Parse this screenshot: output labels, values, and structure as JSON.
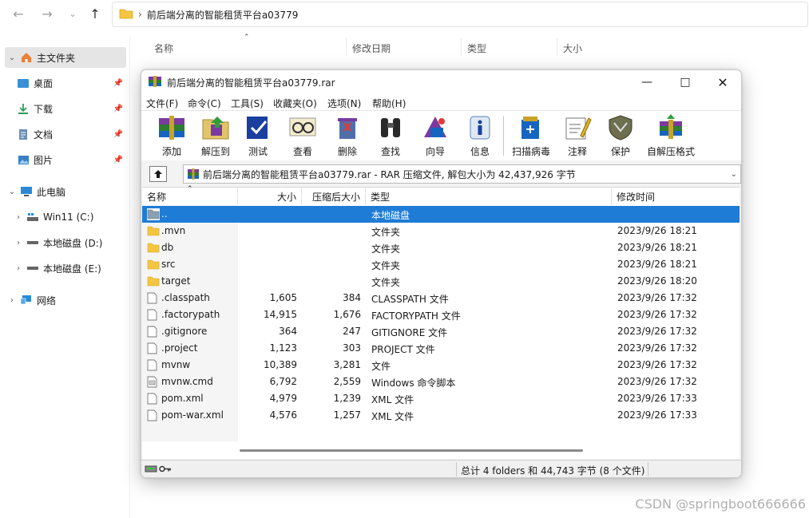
{
  "explorer": {
    "address_path": "前后端分离的智能租赁平台a03779",
    "columns": [
      "名称",
      "修改日期",
      "类型",
      "大小"
    ],
    "sidebar": [
      {
        "label": "主文件夹",
        "icon": "home-icon",
        "selected": true
      },
      {
        "label": "桌面",
        "icon": "desktop-icon",
        "pinned": true
      },
      {
        "label": "下载",
        "icon": "download-icon",
        "pinned": true
      },
      {
        "label": "文档",
        "icon": "document-icon",
        "pinned": true
      },
      {
        "label": "图片",
        "icon": "picture-icon",
        "pinned": true
      },
      {
        "label": "此电脑",
        "icon": "computer-icon"
      },
      {
        "label": "Win11 (C:)",
        "icon": "windows-drive-icon"
      },
      {
        "label": "本地磁盘 (D:)",
        "icon": "drive-icon"
      },
      {
        "label": "本地磁盘 (E:)",
        "icon": "drive-icon"
      },
      {
        "label": "网络",
        "icon": "network-icon"
      }
    ]
  },
  "rar": {
    "title": "前后端分离的智能租赁平台a03779.rar",
    "menu": [
      "文件(F)",
      "命令(C)",
      "工具(S)",
      "收藏夹(O)",
      "选项(N)",
      "帮助(H)"
    ],
    "toolbar": [
      "添加",
      "解压到",
      "测试",
      "查看",
      "删除",
      "查找",
      "向导",
      "信息",
      "扫描病毒",
      "注释",
      "保护",
      "自解压格式"
    ],
    "path": "前后端分离的智能租赁平台a03779.rar - RAR 压缩文件, 解包大小为 42,437,926 字节",
    "columns": {
      "name": "名称",
      "size": "大小",
      "packed": "压缩后大小",
      "type": "类型",
      "modified": "修改时间"
    },
    "files": [
      {
        "name": "..",
        "size": "",
        "packed": "",
        "type": "本地磁盘",
        "modified": "",
        "kind": "up",
        "selected": true
      },
      {
        "name": ".mvn",
        "size": "",
        "packed": "",
        "type": "文件夹",
        "modified": "2023/9/26 18:21",
        "kind": "folder"
      },
      {
        "name": "db",
        "size": "",
        "packed": "",
        "type": "文件夹",
        "modified": "2023/9/26 18:21",
        "kind": "folder"
      },
      {
        "name": "src",
        "size": "",
        "packed": "",
        "type": "文件夹",
        "modified": "2023/9/26 18:21",
        "kind": "folder"
      },
      {
        "name": "target",
        "size": "",
        "packed": "",
        "type": "文件夹",
        "modified": "2023/9/26 18:20",
        "kind": "folder"
      },
      {
        "name": ".classpath",
        "size": "1,605",
        "packed": "384",
        "type": "CLASSPATH 文件",
        "modified": "2023/9/26 17:32",
        "kind": "file"
      },
      {
        "name": ".factorypath",
        "size": "14,915",
        "packed": "1,676",
        "type": "FACTORYPATH 文件",
        "modified": "2023/9/26 17:32",
        "kind": "file"
      },
      {
        "name": ".gitignore",
        "size": "364",
        "packed": "247",
        "type": "GITIGNORE 文件",
        "modified": "2023/9/26 17:32",
        "kind": "file"
      },
      {
        "name": ".project",
        "size": "1,123",
        "packed": "303",
        "type": "PROJECT 文件",
        "modified": "2023/9/26 17:32",
        "kind": "file"
      },
      {
        "name": "mvnw",
        "size": "10,389",
        "packed": "3,281",
        "type": "文件",
        "modified": "2023/9/26 17:32",
        "kind": "file"
      },
      {
        "name": "mvnw.cmd",
        "size": "6,792",
        "packed": "2,559",
        "type": "Windows 命令脚本",
        "modified": "2023/9/26 17:32",
        "kind": "cmd"
      },
      {
        "name": "pom.xml",
        "size": "4,979",
        "packed": "1,239",
        "type": "XML 文件",
        "modified": "2023/9/26 17:33",
        "kind": "file"
      },
      {
        "name": "pom-war.xml",
        "size": "4,576",
        "packed": "1,257",
        "type": "XML 文件",
        "modified": "2023/9/26 17:33",
        "kind": "file"
      }
    ],
    "status": "总计 4 folders 和 44,743 字节 (8 个文件)"
  },
  "watermark": "CSDN @springboot666666",
  "colors": {
    "selection": "#1e7cd6",
    "folder": "#f4c542"
  }
}
